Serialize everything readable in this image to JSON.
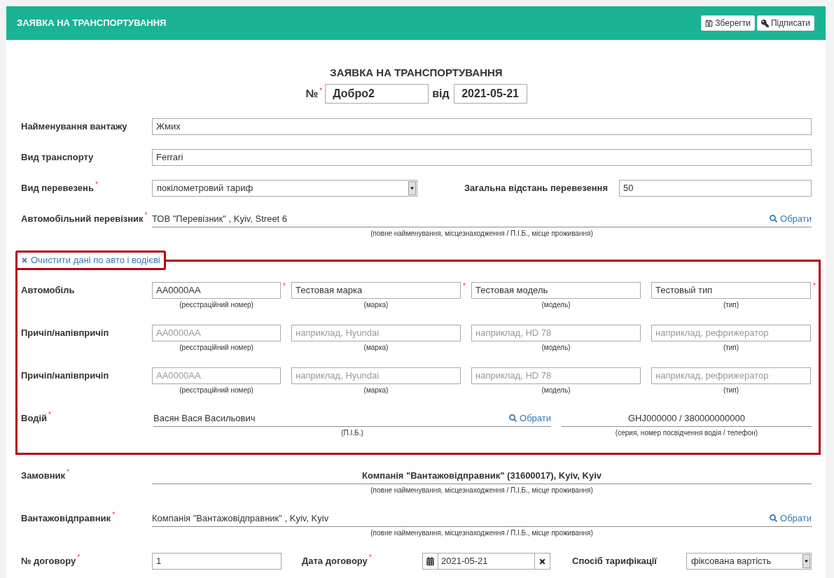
{
  "header": {
    "title": "ЗАЯВКА НА ТРАНСПОРТУВАННЯ",
    "buttons": [
      {
        "kind": "save",
        "label": "Зберегти"
      },
      {
        "kind": "sign",
        "label": "Підписати"
      }
    ]
  },
  "document": {
    "title": "ЗАЯВКА НА ТРАНСПОРТУВАННЯ",
    "number": {
      "label": "№",
      "mark": "*",
      "value": "Добро2"
    },
    "date": {
      "label": "від",
      "value": "2021-05-21"
    }
  },
  "cargo_name": {
    "label": "Найменування вантажу",
    "value": "Жмих"
  },
  "transport_type": {
    "label": "Вид транспорту",
    "value": "Ferrari"
  },
  "transportation_type": {
    "label": "Вид перевезень",
    "mark": "*",
    "value": "покілометровий тариф"
  },
  "total_distance": {
    "label": "Загальна відстань перевезення",
    "value": "50"
  },
  "carrier": {
    "label": "Автомобільний перевізник",
    "mark": "*",
    "value": "ТОВ \"Перевізник\" , Kyiv, Street 6",
    "action": "Обрати",
    "hint": "(повне найменування, місцезнаходження / П.І.Б., місце проживання)"
  },
  "vehicle_section": {
    "clear_button": "Очистити дані по авто і водієві",
    "vehicles": [
      {
        "label": "Автомобіль",
        "fields": [
          {
            "value": "AA0000AA",
            "mark": "*",
            "hint": "(реєстраційний номер)"
          },
          {
            "value": "Тестовая марка",
            "mark": "*",
            "hint": "(марка)"
          },
          {
            "value": "Тестовая модель",
            "hint": "(модель)"
          },
          {
            "value": "Тестовый тип",
            "mark": "*",
            "hint": "(тип)"
          }
        ]
      },
      {
        "label": "Причіп/напівпричіп",
        "fields": [
          {
            "placeholder": "AA0000AA",
            "hint": "(реєстраційний номер)"
          },
          {
            "placeholder": "наприклад, Hyundai",
            "hint": "(марка)"
          },
          {
            "placeholder": "наприклад, HD 78",
            "hint": "(модель)"
          },
          {
            "placeholder": "наприклад, рефрижератор",
            "hint": "(тип)"
          }
        ]
      },
      {
        "label": "Причіп/напівпричіп",
        "fields": [
          {
            "placeholder": "AA0000AA",
            "hint": "(реєстраційний номер)"
          },
          {
            "placeholder": "наприклад, Hyundai",
            "hint": "(марка)"
          },
          {
            "placeholder": "наприклад, HD 78",
            "hint": "(модель)"
          },
          {
            "placeholder": "наприклад, рефрижератор",
            "hint": "(тип)"
          }
        ]
      }
    ],
    "driver": {
      "label": "Водій",
      "mark": "*",
      "name": "Васян Вася Васильович",
      "action": "Обрати",
      "name_hint": "(П.І.Б.)",
      "license": "GHJ000000 / 380000000000",
      "license_hint": "(серия, номер посвідчення водія / телефон)"
    }
  },
  "customer": {
    "label": "Замовник",
    "mark": "*",
    "value": "Компанія \"Вантажовідправник\" (31600017), Kyiv, Kyiv",
    "hint": "(повне найменування, місцезнаходження / П.І.Б., місце проживання)"
  },
  "shipper": {
    "label": "Вантажовідправник",
    "mark": "*",
    "value": "Компанія \"Вантажовідправник\" , Kyiv, Kyiv",
    "action": "Обрати",
    "hint": "(повне найменування, місцезнаходження / П.І.Б., місце проживання)"
  },
  "contract": {
    "number": {
      "label": "№ договору",
      "mark": "*",
      "value": "1"
    },
    "date": {
      "label": "Дата договору",
      "mark": "*",
      "value": "2021-05-21"
    },
    "pricing": {
      "label": "Спосіб тарифікації",
      "value": "фіксована вартість"
    }
  }
}
